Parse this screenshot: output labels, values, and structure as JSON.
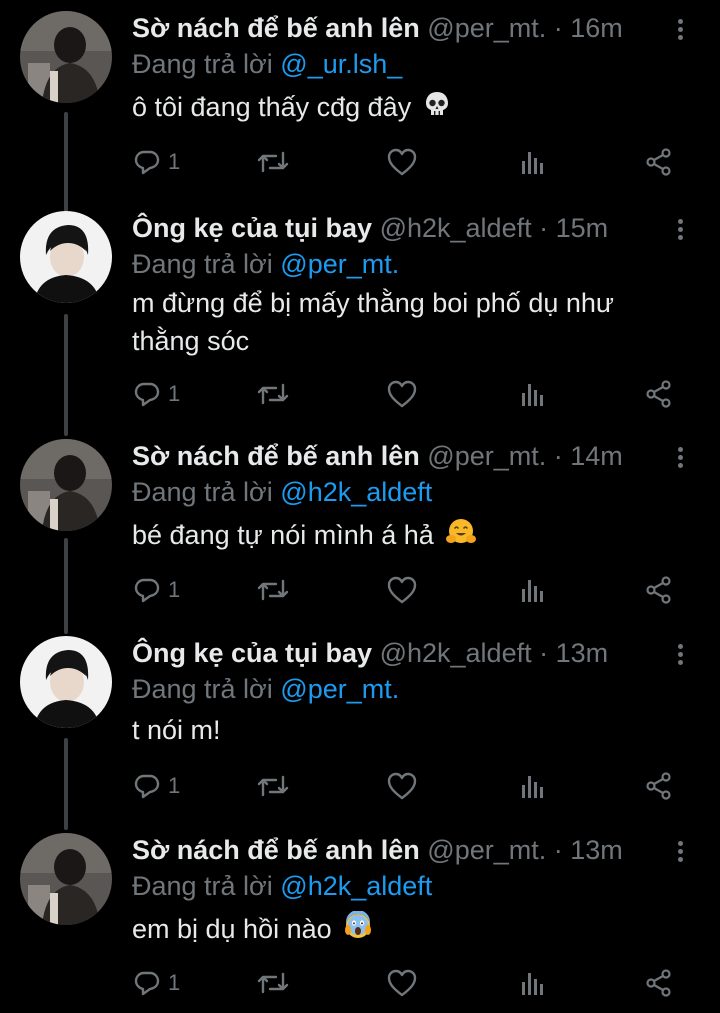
{
  "colors": {
    "background": "#000000",
    "text_primary": "#e7e9ea",
    "text_secondary": "#71767b",
    "mention": "#1d9bf0",
    "thread_line": "#3e4144"
  },
  "tweets": [
    {
      "name": "Sờ nách để bế anh lên",
      "handle": "@per_mt.",
      "separator": "·",
      "time": "16m",
      "replying_prefix": "Đang trả lời",
      "replying_to": "@_ur.lsh_",
      "text": "ô tôi đang thấy cđg đây",
      "emoji": "skull-emoji",
      "reply_count": "1",
      "avatar": "avatar-dark-photo"
    },
    {
      "name": "Ông kẹ của tụi bay",
      "handle": "@h2k_aldeft",
      "separator": "·",
      "time": "15m",
      "replying_prefix": "Đang trả lời",
      "replying_to": "@per_mt.",
      "text": "m đừng để bị mấy thằng boi phố dụ như thằng sóc",
      "emoji": "",
      "reply_count": "1",
      "avatar": "avatar-light-photo"
    },
    {
      "name": "Sờ nách để bế anh lên",
      "handle": "@per_mt.",
      "separator": "·",
      "time": "14m",
      "replying_prefix": "Đang trả lời",
      "replying_to": "@h2k_aldeft",
      "text": "bé đang tự nói mình á hả",
      "emoji": "hugging-face-emoji",
      "reply_count": "1",
      "avatar": "avatar-dark-photo"
    },
    {
      "name": "Ông kẹ của tụi bay",
      "handle": "@h2k_aldeft",
      "separator": "·",
      "time": "13m",
      "replying_prefix": "Đang trả lời",
      "replying_to": "@per_mt.",
      "text": "t nói m!",
      "emoji": "",
      "reply_count": "1",
      "avatar": "avatar-light-photo"
    },
    {
      "name": "Sờ nách để bế anh lên",
      "handle": "@per_mt.",
      "separator": "·",
      "time": "13m",
      "replying_prefix": "Đang trả lời",
      "replying_to": "@h2k_aldeft",
      "text": "em bị dụ hồi nào",
      "emoji": "screaming-face-emoji",
      "reply_count": "1",
      "avatar": "avatar-dark-photo"
    }
  ],
  "action_icons": [
    "reply-icon",
    "retweet-icon",
    "like-icon",
    "views-icon",
    "share-icon"
  ]
}
